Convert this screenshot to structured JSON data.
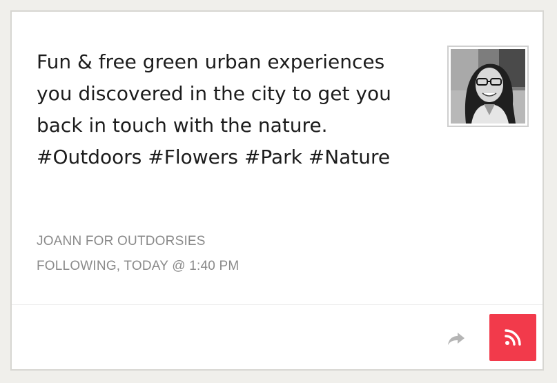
{
  "post": {
    "text": "Fun & free green urban experiences you discovered in the city to get you back in touch with the nature. #Outdoors #Flowers #Park #Nature",
    "author_line": "JOANN FOR OUTDORSIES",
    "status_line": "FOLLOWING, TODAY @ 1:40 PM"
  },
  "icons": {
    "share": "share-arrow-icon",
    "follow": "rss-feed-icon",
    "avatar": "user-avatar-photo"
  },
  "colors": {
    "accent": "#f23a4b",
    "meta_text": "#8a8a8a",
    "body_text": "#1c1c1c",
    "background": "#f0efeb"
  }
}
